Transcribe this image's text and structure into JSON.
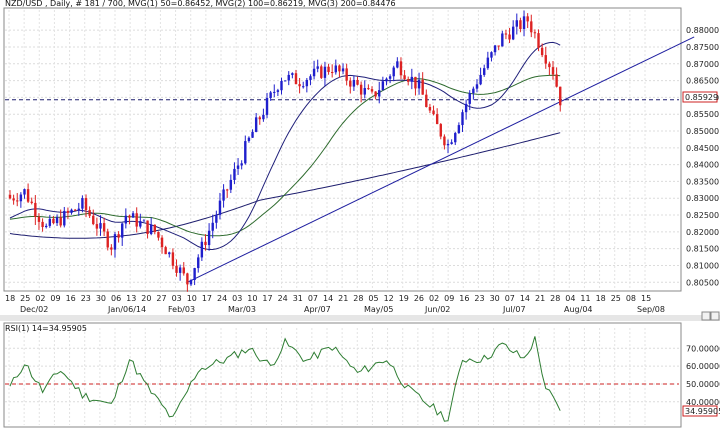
{
  "header": {
    "main": "NZD/USD , Daily, # 181 / 700, MVG(1) 50=0.86452, MVG(2) 100=0.86219, MVG(3) 200=0.84476",
    "rsi": "RSI(1) 14=34.95905"
  },
  "price_tag": "0.85929",
  "rsi_tag": "34.95905",
  "colors": {
    "bull": "#1f1fcc",
    "bear": "#dd2222",
    "ma50": "#20207a",
    "ma100": "#2e6b2e",
    "ma200": "#1e1e6e",
    "trend": "#1f1fa0",
    "rsi": "#2e7d32",
    "level": "#cc2222"
  },
  "chart_data": [
    {
      "type": "candlestick",
      "title": "NZD/USD , Daily",
      "y_ticks": [
        "0.88000",
        "0.87500",
        "0.87000",
        "0.86500",
        "0.86000",
        "0.85500",
        "0.85000",
        "0.84500",
        "0.84000",
        "0.83500",
        "0.83000",
        "0.82500",
        "0.82000",
        "0.81500",
        "0.81000",
        "0.80500"
      ],
      "ylim": [
        0.803,
        0.886
      ],
      "x_day_labels": [
        "18",
        "25",
        "02",
        "09",
        "16",
        "23",
        "30",
        "06",
        "13",
        "20",
        "27",
        "03",
        "10",
        "17",
        "24",
        "03",
        "10",
        "17",
        "24",
        "31",
        "07",
        "14",
        "21",
        "28",
        "05",
        "12",
        "19",
        "26",
        "02",
        "09",
        "16",
        "23",
        "30",
        "07",
        "14",
        "21",
        "28",
        "04",
        "11",
        "18",
        "25",
        "08",
        "15"
      ],
      "x_month_labels": [
        "Dec/02",
        "Jan/06/14",
        "Feb/03",
        "Mar/03",
        "Apr/07",
        "May/05",
        "Jun/02",
        "Jul/07",
        "Aug/04",
        "Sep/08"
      ],
      "key_closes": [
        {
          "i": 0,
          "v": 0.83
        },
        {
          "i": 4,
          "v": 0.832
        },
        {
          "i": 10,
          "v": 0.821
        },
        {
          "i": 20,
          "v": 0.828
        },
        {
          "i": 28,
          "v": 0.816
        },
        {
          "i": 32,
          "v": 0.825
        },
        {
          "i": 40,
          "v": 0.82
        },
        {
          "i": 49,
          "v": 0.805
        },
        {
          "i": 58,
          "v": 0.828
        },
        {
          "i": 68,
          "v": 0.852
        },
        {
          "i": 75,
          "v": 0.866
        },
        {
          "i": 80,
          "v": 0.865
        },
        {
          "i": 89,
          "v": 0.869
        },
        {
          "i": 100,
          "v": 0.86
        },
        {
          "i": 107,
          "v": 0.87
        },
        {
          "i": 113,
          "v": 0.863
        },
        {
          "i": 117,
          "v": 0.853
        },
        {
          "i": 121,
          "v": 0.846
        },
        {
          "i": 125,
          "v": 0.856
        },
        {
          "i": 129,
          "v": 0.865
        },
        {
          "i": 136,
          "v": 0.878
        },
        {
          "i": 143,
          "v": 0.883
        },
        {
          "i": 150,
          "v": 0.868
        },
        {
          "i": 152,
          "v": 0.8593
        }
      ],
      "ma_series": [
        {
          "name": "MVG(1) 50",
          "last": 0.86452
        },
        {
          "name": "MVG(2) 100",
          "last": 0.86219
        },
        {
          "name": "MVG(3) 200",
          "last": 0.84476
        }
      ],
      "trendline": [
        {
          "i": 49,
          "v": 0.805
        },
        {
          "i": 189,
          "v": 0.878
        }
      ],
      "current_level": 0.85929
    },
    {
      "type": "line",
      "title": "RSI(1) 14",
      "y_ticks": [
        "70.00000",
        "60.00000",
        "50.00000",
        "40.00000"
      ],
      "ylim": [
        27,
        78
      ],
      "reference_level": 50,
      "key_values": [
        {
          "i": 0,
          "v": 48
        },
        {
          "i": 4,
          "v": 62
        },
        {
          "i": 9,
          "v": 46
        },
        {
          "i": 14,
          "v": 58
        },
        {
          "i": 20,
          "v": 44
        },
        {
          "i": 28,
          "v": 38
        },
        {
          "i": 33,
          "v": 64
        },
        {
          "i": 38,
          "v": 48
        },
        {
          "i": 45,
          "v": 30
        },
        {
          "i": 52,
          "v": 58
        },
        {
          "i": 60,
          "v": 64
        },
        {
          "i": 66,
          "v": 70
        },
        {
          "i": 72,
          "v": 60
        },
        {
          "i": 76,
          "v": 73
        },
        {
          "i": 82,
          "v": 63
        },
        {
          "i": 89,
          "v": 71
        },
        {
          "i": 96,
          "v": 56
        },
        {
          "i": 104,
          "v": 64
        },
        {
          "i": 110,
          "v": 47
        },
        {
          "i": 116,
          "v": 38
        },
        {
          "i": 121,
          "v": 30
        },
        {
          "i": 125,
          "v": 64
        },
        {
          "i": 131,
          "v": 64
        },
        {
          "i": 136,
          "v": 72
        },
        {
          "i": 142,
          "v": 64
        },
        {
          "i": 145,
          "v": 75
        },
        {
          "i": 148,
          "v": 48
        },
        {
          "i": 152,
          "v": 35
        }
      ],
      "last": 34.95905
    }
  ]
}
